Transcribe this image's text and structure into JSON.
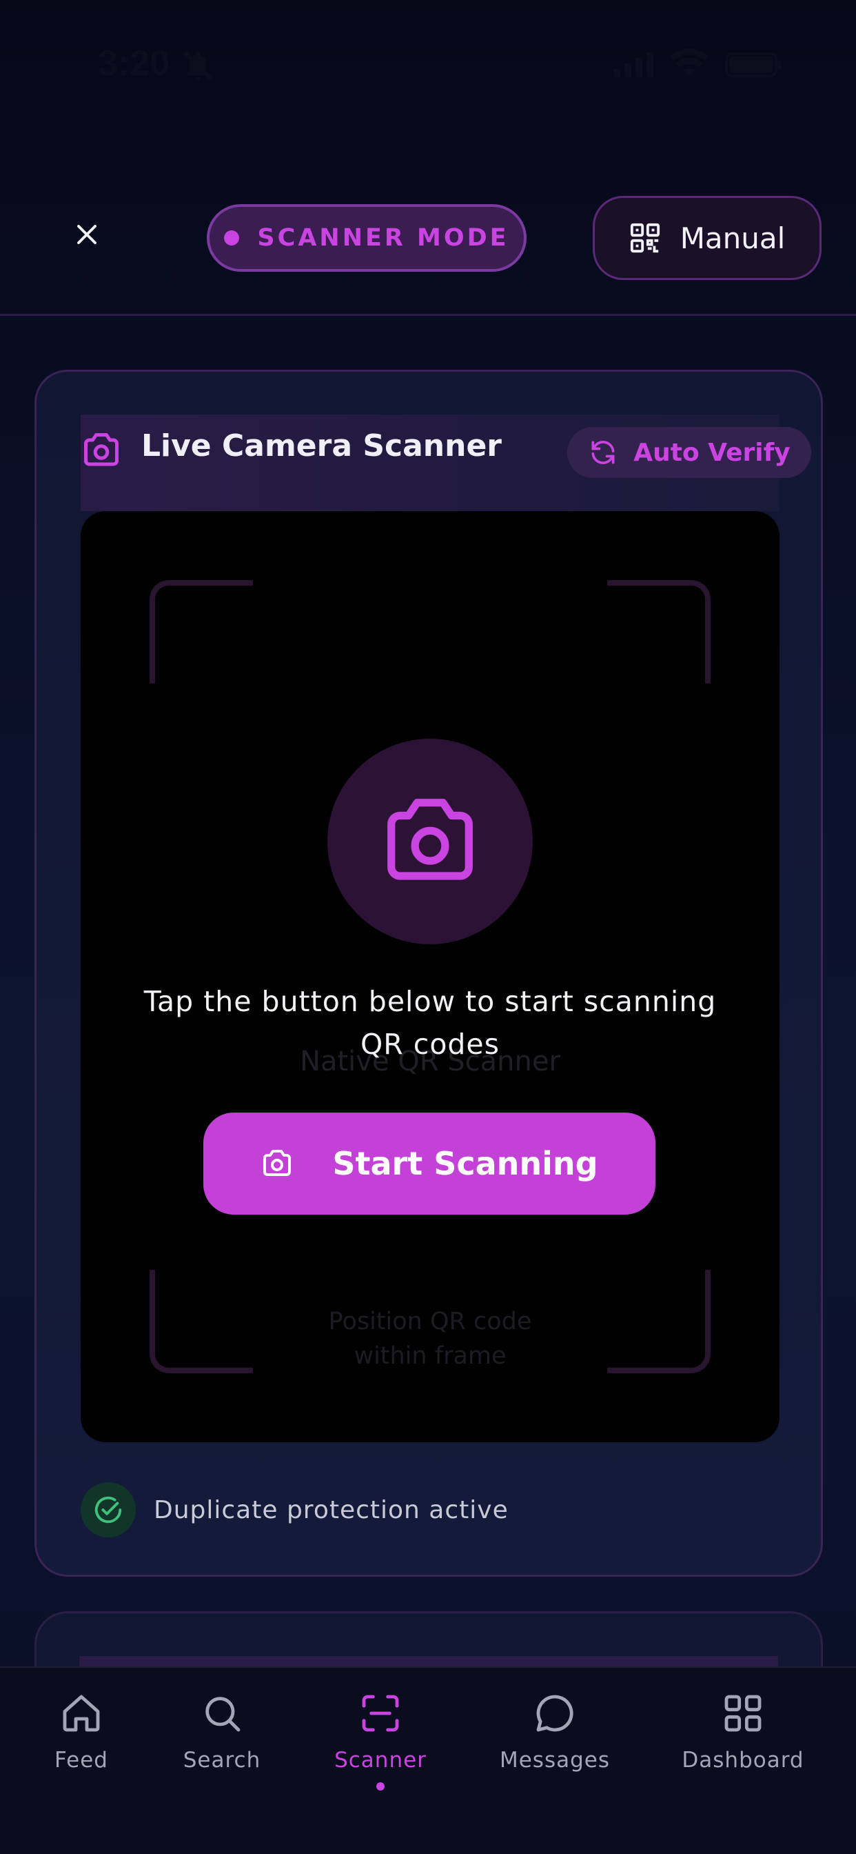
{
  "status_bar": {
    "time": "3:20",
    "icons": [
      "bell-slash-icon",
      "signal-icon",
      "wifi-icon",
      "battery-icon"
    ]
  },
  "header": {
    "close_icon": "close-icon",
    "mode_label": "SCANNER MODE",
    "manual_label": "Manual",
    "manual_icon": "qr-code-icon"
  },
  "scanner_card": {
    "title": "Live Camera Scanner",
    "title_icon": "camera-icon",
    "auto_verify_label": "Auto Verify",
    "auto_verify_icon": "refresh-icon",
    "background_label": "Native QR Scanner",
    "background_hint": "Position QR code\nwithin frame",
    "prompt": "Tap the button below to start scanning QR codes",
    "start_button_label": "Start Scanning",
    "duplicate_label": "Duplicate protection active"
  },
  "tabs": [
    {
      "label": "Feed",
      "icon": "home-icon",
      "active": false
    },
    {
      "label": "Search",
      "icon": "search-icon",
      "active": false
    },
    {
      "label": "Scanner",
      "icon": "scan-icon",
      "active": true
    },
    {
      "label": "Messages",
      "icon": "chat-icon",
      "active": false
    },
    {
      "label": "Dashboard",
      "icon": "grid-icon",
      "active": false
    }
  ],
  "colors": {
    "accent": "#c944e0",
    "background": "#0a0f26",
    "success": "#3ec27a"
  }
}
